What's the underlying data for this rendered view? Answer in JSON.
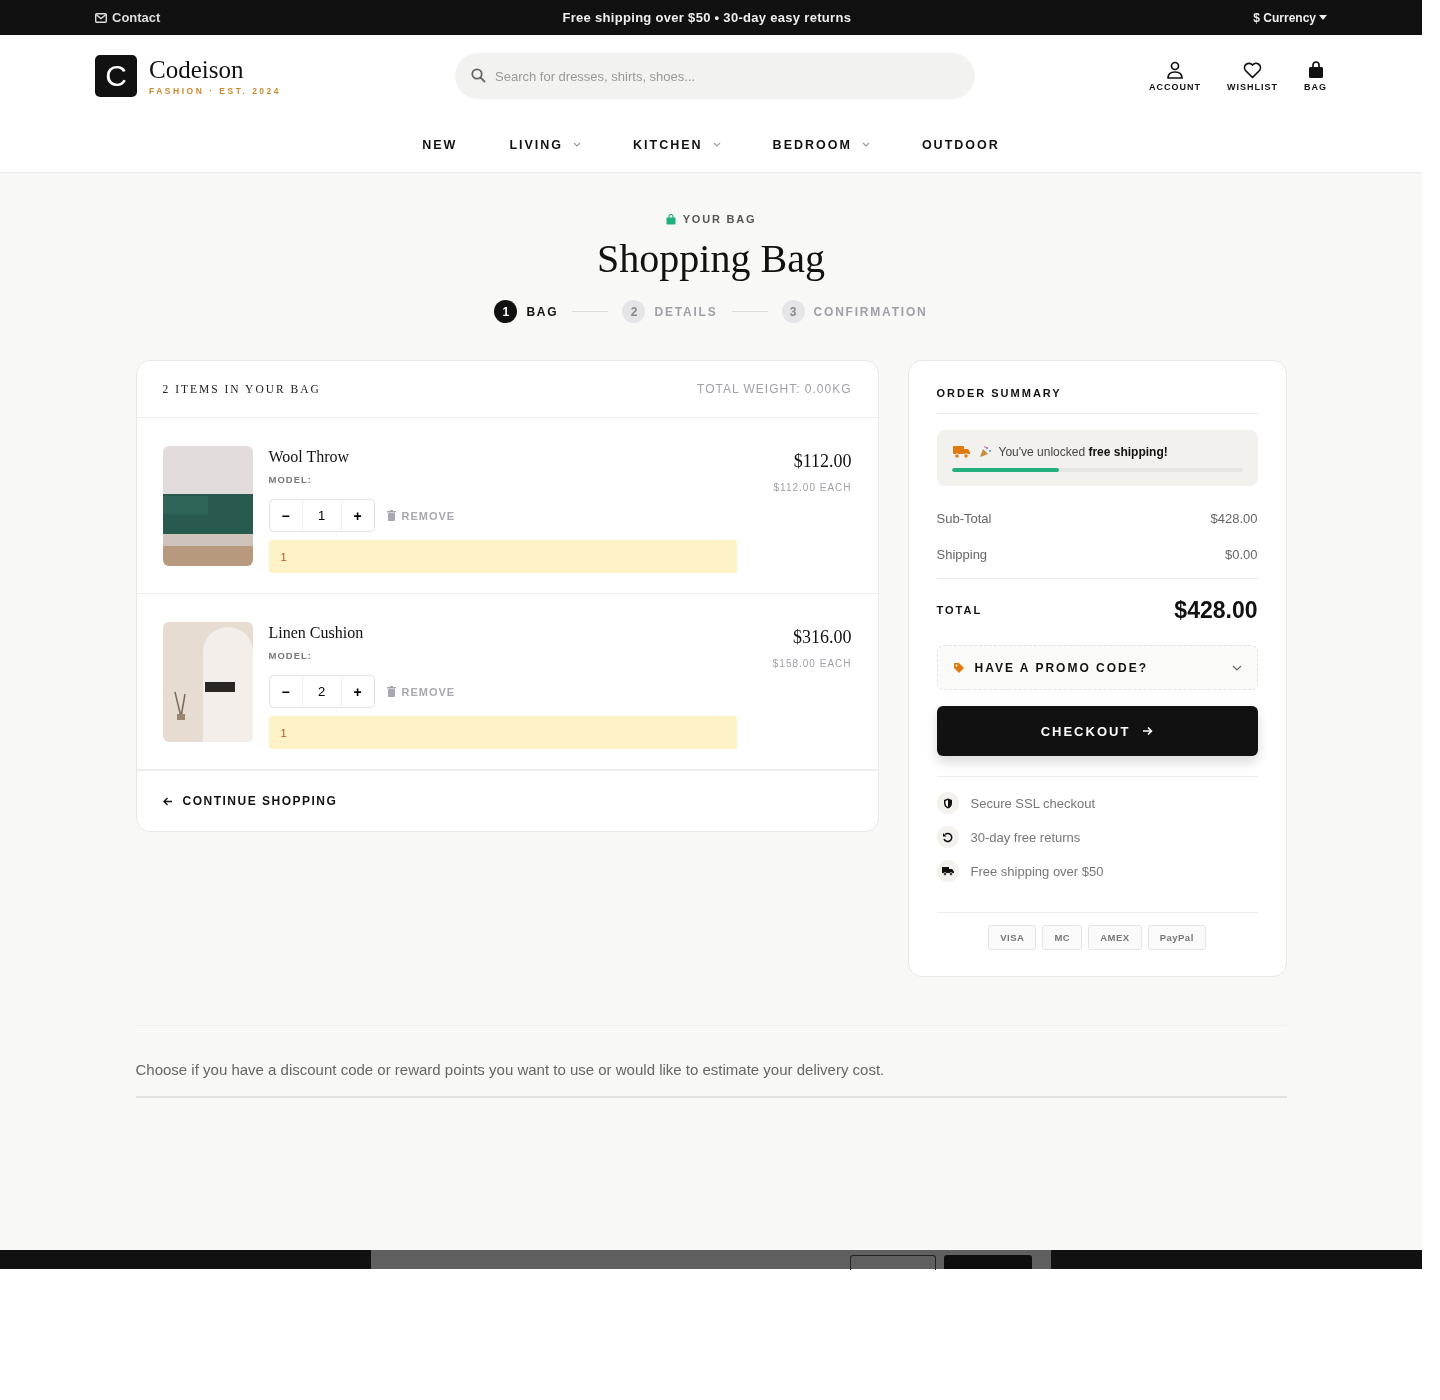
{
  "top_bar": {
    "contact": "Contact",
    "promo": "Free shipping over $50 • 30-day easy returns",
    "currency": "$ Currency"
  },
  "header": {
    "logo_letter": "C",
    "brand": "Codeison",
    "tagline": "FASHION · EST. 2024",
    "search": {
      "placeholder": "Search for dresses, shirts, shoes..."
    },
    "actions": [
      {
        "kind": "account",
        "label": "ACCOUNT"
      },
      {
        "kind": "wishlist",
        "label": "WISHLIST"
      },
      {
        "kind": "bag",
        "label": "BAG"
      }
    ]
  },
  "nav": [
    {
      "label": "NEW",
      "has_menu": false
    },
    {
      "label": "LIVING",
      "has_menu": true
    },
    {
      "label": "KITCHEN",
      "has_menu": true
    },
    {
      "label": "BEDROOM",
      "has_menu": true
    },
    {
      "label": "OUTDOOR",
      "has_menu": false
    }
  ],
  "page": {
    "eyebrow": "YOUR BAG",
    "title": "Shopping Bag"
  },
  "steps": [
    {
      "number": "1",
      "label": "BAG",
      "selected": true
    },
    {
      "number": "2",
      "label": "DETAILS",
      "selected": false
    },
    {
      "number": "3",
      "label": "CONFIRMATION",
      "selected": false
    }
  ],
  "bag": {
    "count_label": "2 ITEMS IN YOUR BAG",
    "weight": "TOTAL WEIGHT: 0.00KG",
    "items": [
      {
        "name": "Wool Throw",
        "model": "MODEL:",
        "quantity": "1",
        "remove": "REMOVE",
        "note": "1",
        "price": "$112.00",
        "each": "$112.00 EACH",
        "kind": "sofa",
        "decrease": "−",
        "increase": "+"
      },
      {
        "name": "Linen Cushion",
        "model": "MODEL:",
        "quantity": "2",
        "remove": "REMOVE",
        "note": "1",
        "price": "$316.00",
        "each": "$158.00 EACH",
        "kind": "interior",
        "decrease": "−",
        "increase": "+"
      }
    ],
    "continue": "CONTINUE SHOPPING"
  },
  "summary": {
    "title": "ORDER SUMMARY",
    "shipping_banner": {
      "text": "You've unlocked **free shipping!**",
      "level": 0.37
    },
    "lines": [
      {
        "label": "Sub-Total",
        "value": "$428.00"
      },
      {
        "label": "Shipping",
        "value": "$0.00"
      }
    ],
    "total_label": "TOTAL",
    "total": "$428.00",
    "promo": {
      "label": "HAVE A PROMO CODE?",
      "expanded": false
    },
    "checkout": "CHECKOUT",
    "perks": [
      {
        "kind": "shield",
        "text": "Secure SSL checkout"
      },
      {
        "kind": "returns",
        "text": "30-day free returns"
      },
      {
        "kind": "truck",
        "text": "Free shipping over $50"
      }
    ],
    "payments": [
      "VISA",
      "MC",
      "AMEX",
      "PayPal"
    ]
  },
  "footer_note": "Choose if you have a discount code or reward points you want to use or would like to estimate your delivery cost."
}
